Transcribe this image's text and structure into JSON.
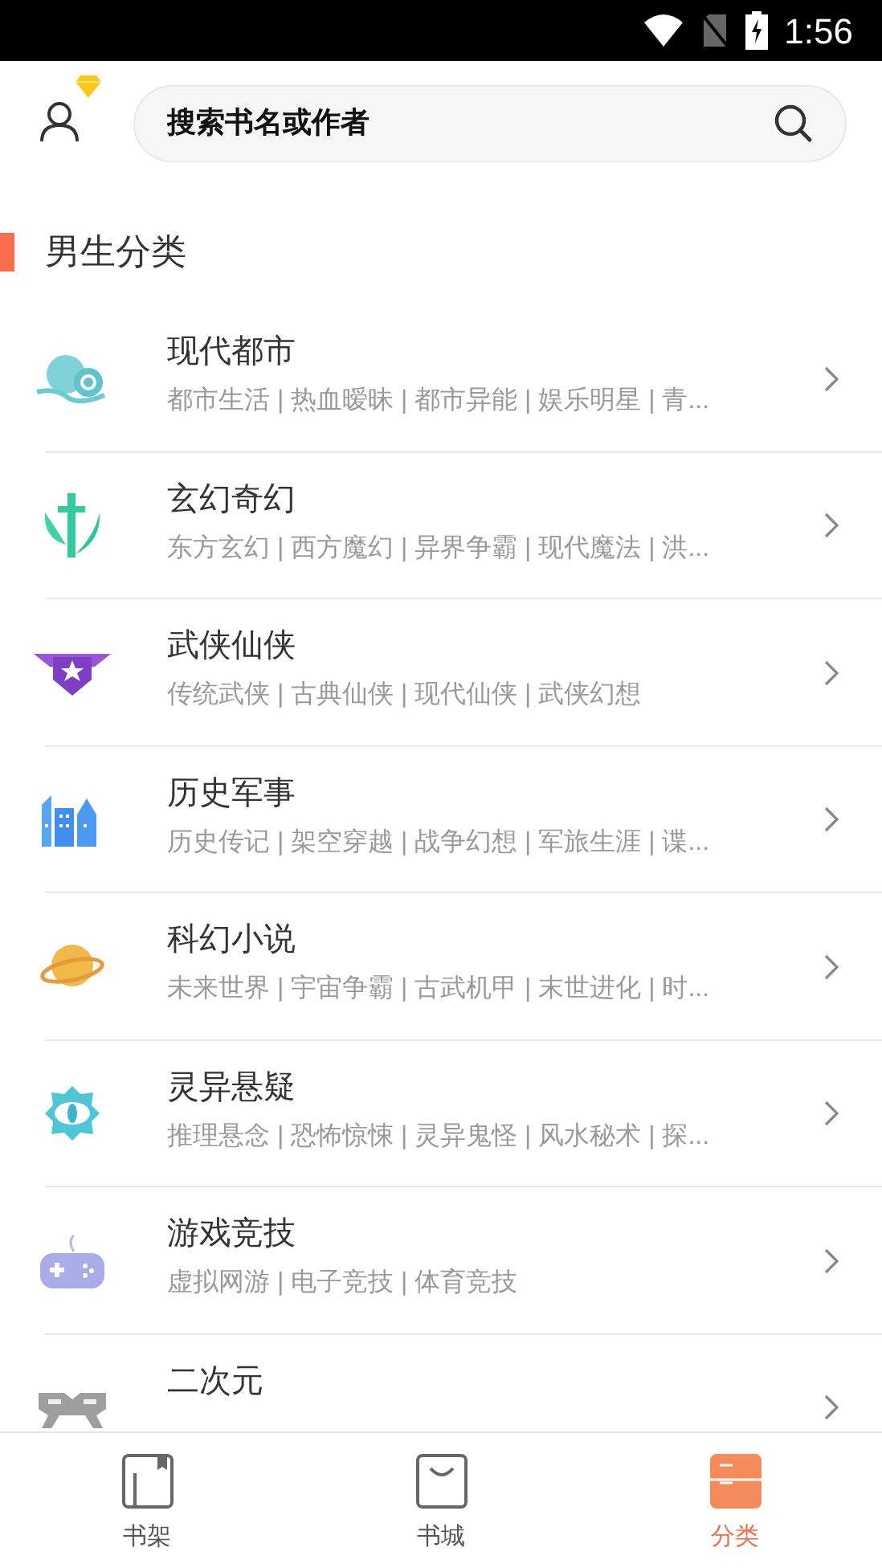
{
  "status_bar": {
    "time": "1:56"
  },
  "search": {
    "placeholder": "搜索书名或作者"
  },
  "section": {
    "title": "男生分类"
  },
  "categories": [
    {
      "title": "现代都市",
      "tags": "都市生活 | 热血暧昧 | 都市异能 | 娱乐明星 | 青..."
    },
    {
      "title": "玄幻奇幻",
      "tags": "东方玄幻 | 西方魔幻 | 异界争霸 | 现代魔法 | 洪..."
    },
    {
      "title": "武侠仙侠",
      "tags": "传统武侠 | 古典仙侠 | 现代仙侠 | 武侠幻想"
    },
    {
      "title": "历史军事",
      "tags": "历史传记 | 架空穿越 | 战争幻想 | 军旅生涯 | 谍..."
    },
    {
      "title": "科幻小说",
      "tags": "未来世界 | 宇宙争霸 | 古武机甲 | 末世进化 | 时..."
    },
    {
      "title": "灵异悬疑",
      "tags": "推理悬念 | 恐怖惊悚 | 灵异鬼怪 | 风水秘术 | 探..."
    },
    {
      "title": "游戏竞技",
      "tags": "虚拟网游 | 电子竞技 | 体育竞技"
    },
    {
      "title": "二次元"
    }
  ],
  "bottom_nav": [
    {
      "label": "书架",
      "selected": false
    },
    {
      "label": "书城",
      "selected": false
    },
    {
      "label": "分类",
      "selected": true
    }
  ]
}
